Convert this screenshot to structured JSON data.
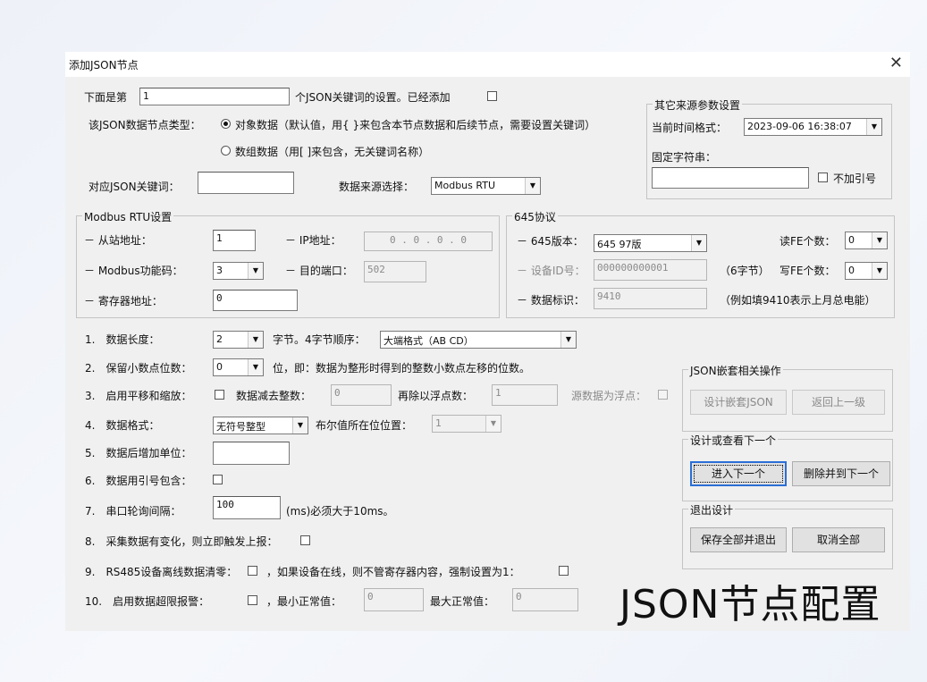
{
  "window": {
    "title": "添加JSON节点",
    "close_icon": "✕"
  },
  "top": {
    "position_label": "下面是第",
    "position_value": "1",
    "position_suffix": "个JSON关键词的设置。已经添加",
    "type_label": "该JSON数据节点类型：",
    "radio_object": "对象数据（默认值，用{ }来包含本节点数据和后续节点，需要设置关键词）",
    "radio_array": "数组数据（用[ ]来包含，无关键词名称）",
    "keyword_label": "对应JSON关键词：",
    "keyword_value": "",
    "source_label": "数据来源选择：",
    "source_value": "Modbus RTU"
  },
  "other_source": {
    "group_title": "其它来源参数设置",
    "time_format_label": "当前时间格式：",
    "time_format_value": "2023-09-06 16:38:07",
    "fixed_string_label": "固定字符串：",
    "fixed_string_value": "",
    "no_quote_label": "不加引号"
  },
  "modbus": {
    "group_title": "Modbus RTU设置",
    "slave_label": "－ 从站地址：",
    "slave_value": "1",
    "func_label": "－ Modbus功能码：",
    "func_value": "3",
    "reg_label": "－ 寄存器地址：",
    "reg_value": "0",
    "ip_label": "－ IP地址：",
    "ip_value": "0 . 0 . 0 . 0",
    "port_label": "－ 目的端口：",
    "port_value": "502"
  },
  "p645": {
    "group_title": "645协议",
    "version_label": "－ 645版本：",
    "version_value": "645 97版",
    "read_fe_label": "读FE个数：",
    "read_fe_value": "0",
    "device_label": "－ 设备ID号：",
    "device_value": "000000000001",
    "device_hint": "（6字节）",
    "write_fe_label": "写FE个数：",
    "write_fe_value": "0",
    "data_id_label": "－ 数据标识：",
    "data_id_value": "9410",
    "data_id_hint": "（例如填9410表示上月总电能）"
  },
  "options": {
    "r1_label": "1.　数据长度：",
    "r1_value": "2",
    "r1_mid": "字节。4字节顺序：",
    "r1_order": "大端格式（AB CD）",
    "r2_label": "2.　保留小数点位数：",
    "r2_value": "0",
    "r2_hint": "位，即：数据为整形时得到的整数小数点左移的位数。",
    "r3_label": "3.　启用平移和缩放：",
    "r3_sub": "数据减去整数：",
    "r3_sub_value": "0",
    "r3_div": "再除以浮点数：",
    "r3_div_value": "1",
    "r3_float": "源数据为浮点：",
    "r4_label": "4.　数据格式：",
    "r4_value": "无符号整型",
    "r4_bool": "布尔值所在位位置：",
    "r4_bool_value": "1",
    "r5_label": "5.　数据后增加单位：",
    "r5_value": "",
    "r6_label": "6.　数据用引号包含：",
    "r7_label": "7.　串口轮询间隔：",
    "r7_value": "100",
    "r7_hint": "(ms)必须大于10ms。",
    "r8_label": "8.　采集数据有变化，则立即触发上报：",
    "r9_label": "9.　RS485设备离线数据清零：",
    "r9_mid": "，如果设备在线，则不管寄存器内容，强制设置为1：",
    "r10_label": "10.　启用数据超限报警：",
    "r10_min": "，最小正常值：",
    "r10_min_value": "0",
    "r10_max": "最大正常值：",
    "r10_max_value": "0"
  },
  "json_nested": {
    "group_title": "JSON嵌套相关操作",
    "design_nested": "设计嵌套JSON",
    "back_up": "返回上一级"
  },
  "design_next": {
    "group_title": "设计或查看下一个",
    "enter_next": "进入下一个",
    "delete_next": "删除并到下一个"
  },
  "exit": {
    "group_title": "退出设计",
    "save_exit": "保存全部并退出",
    "cancel_all": "取消全部"
  },
  "watermark": "JSON节点配置"
}
